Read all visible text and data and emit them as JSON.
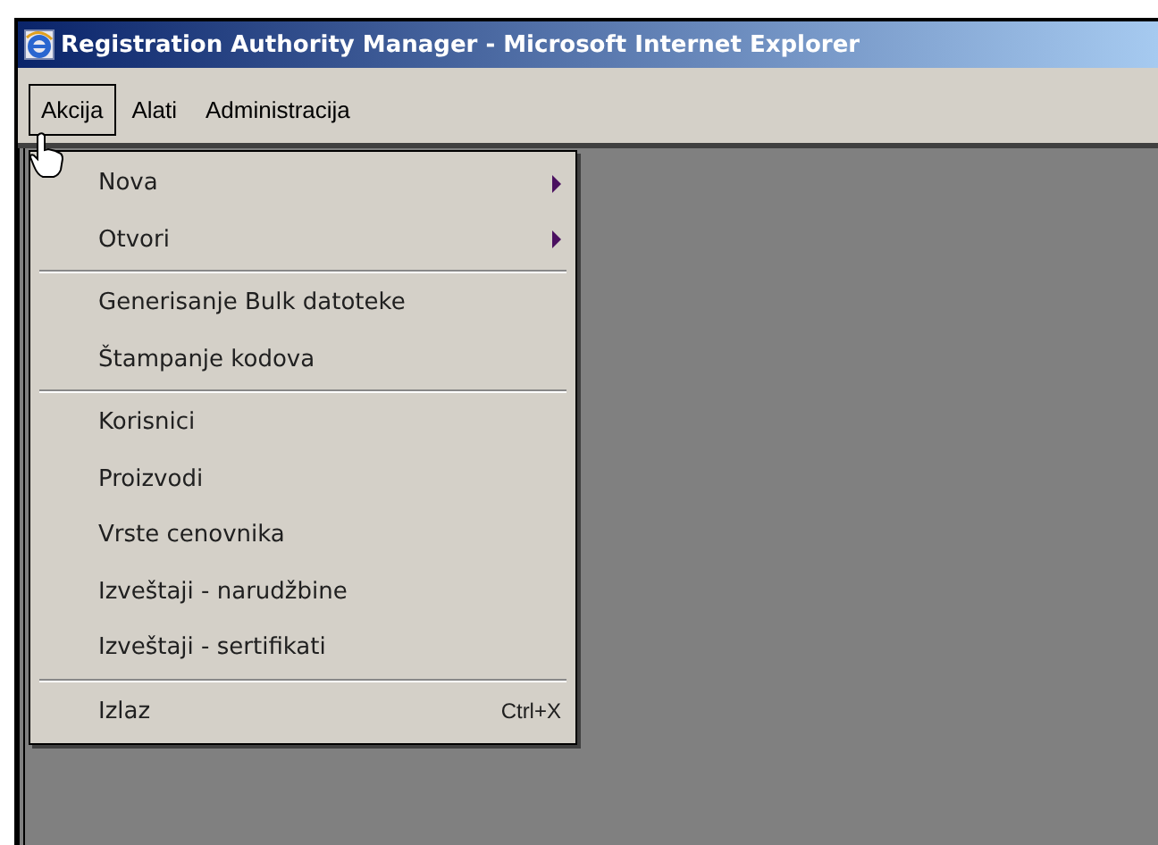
{
  "window": {
    "title": "Registration Authority Manager - Microsoft Internet Explorer"
  },
  "menu_bar": [
    {
      "label": "Akcija",
      "selected": true
    },
    {
      "label": "Alati",
      "selected": false
    },
    {
      "label": "Administracija",
      "selected": false
    }
  ],
  "dropdown": {
    "groups": [
      [
        {
          "label": "Nova",
          "submenu": true
        },
        {
          "label": "Otvori",
          "submenu": true
        }
      ],
      [
        {
          "label": "Generisanje Bulk datoteke",
          "submenu": false
        },
        {
          "label": "Štampanje kodova",
          "submenu": false
        }
      ],
      [
        {
          "label": "Korisnici",
          "submenu": false
        },
        {
          "label": "Proizvodi",
          "submenu": false
        },
        {
          "label": "Vrste cenovnika",
          "submenu": false
        },
        {
          "label": "Izveštaji - narudžbine",
          "submenu": false
        },
        {
          "label": "Izveštaji - sertifikati",
          "submenu": false
        }
      ],
      [
        {
          "label": "Izlaz",
          "submenu": false,
          "shortcut": "Ctrl+X"
        }
      ]
    ]
  }
}
